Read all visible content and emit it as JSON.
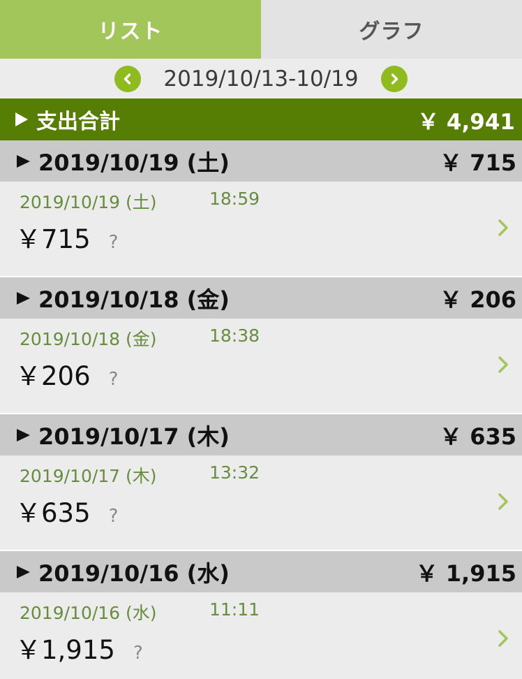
{
  "tabs": [
    {
      "label": "リスト",
      "active": true
    },
    {
      "label": "グラフ",
      "active": false
    }
  ],
  "week_nav": {
    "range": "2019/10/13-10/19"
  },
  "summary": {
    "label": "支出合計",
    "amount": "￥ 4,941"
  },
  "days": [
    {
      "date": "2019/10/19 (土)",
      "total": "￥ 715",
      "entry": {
        "date": "2019/10/19 (土)",
        "time": "18:59",
        "amount": "￥715",
        "category": "?"
      }
    },
    {
      "date": "2019/10/18 (金)",
      "total": "￥ 206",
      "entry": {
        "date": "2019/10/18 (金)",
        "time": "18:38",
        "amount": "￥206",
        "category": "?"
      }
    },
    {
      "date": "2019/10/17 (木)",
      "total": "￥ 635",
      "entry": {
        "date": "2019/10/17 (木)",
        "time": "13:32",
        "amount": "￥635",
        "category": "?"
      }
    },
    {
      "date": "2019/10/16 (水)",
      "total": "￥ 1,915",
      "entry": {
        "date": "2019/10/16 (水)",
        "time": "11:11",
        "amount": "￥1,915",
        "category": "?"
      }
    }
  ],
  "colors": {
    "tab_active": "#a3c65a",
    "total_bar": "#567e05",
    "nav_button": "#8fbb1f",
    "meta_text": "#678d3e",
    "chevron": "#a3c65a"
  },
  "icons": {
    "prev": "chevron-left-icon",
    "next": "chevron-right-icon",
    "expand": "triangle-right-icon",
    "row": "chevron-right-icon"
  }
}
